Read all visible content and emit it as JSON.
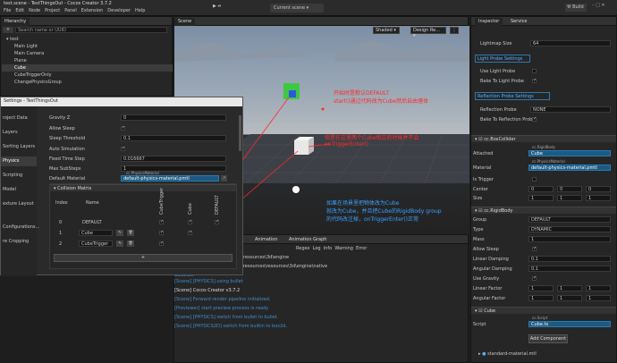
{
  "window": {
    "title": "test.scene - TestThingsOut - Cocos Creator 3.7.2"
  },
  "menu": [
    "File",
    "Edit",
    "Node",
    "Project",
    "Panel",
    "Extension",
    "Developer",
    "Help"
  ],
  "toolbar": {
    "scene_select": "Current scene",
    "build": "Build"
  },
  "hierarchy": {
    "title": "Hierarchy",
    "search_placeholder": "Search name or UUID",
    "nodes": [
      "test",
      "Main Light",
      "Main Camera",
      "Plane",
      "Cube",
      "CubeTriggerOnly",
      "ChangePhysicsGroup"
    ]
  },
  "scene": {
    "tab": "Scene",
    "shading": "Shaded",
    "design": "Design Re...",
    "annotations": [
      "开始时是默认DEFAULT",
      "start()通过代码改为Cube然后自由落体",
      "但是在这里两个Cube相交的时候并不会",
      "onTriggerEnter()",
      "如果在场景里把物体改为Cube",
      "就改为Cube，并且把Cube的RigidBody group",
      "的代码改注掉，onTriggerEnter()正常"
    ]
  },
  "bottom": {
    "tabs": [
      "Animation",
      "Animation Graph"
    ],
    "console_filters": [
      "Regex",
      "Log",
      "Info",
      "Warning",
      "Error"
    ],
    "paths": [
      "editor\\Creator\\3.7.2\\resources\\resources\\3d\\engine",
      "ata\\cocos\\editor\\Creator\\3.7.2\\resources\\resources\\3d\\engine\\native",
      "build.dts"
    ],
    "logs": [
      "[Scene] [PHYSICS] using bullet",
      "[Scene] Cocos Creator v3.7.2",
      "[Scene] Forward render pipeline initialized.",
      "[Previewer] start preview process is ready",
      "[Scene] [PHYSICS] switch from bullet to bullet.",
      "[Scene] [PHYSICS2D] switch from builtin to box2d."
    ]
  },
  "settings": {
    "title": "Settings - TestThingsOut",
    "side": [
      "roject Data",
      "Layers",
      "Sorting Layers",
      "Physics",
      "Scripting",
      "Model",
      "exture Layout",
      "Configurations...",
      "re Cropping"
    ],
    "fields": [
      {
        "label": "Gravity Z",
        "value": "0"
      },
      {
        "label": "Allow Sleep",
        "value": ""
      },
      {
        "label": "Sleep Threshold",
        "value": "0.1"
      },
      {
        "label": "Auto Simulation",
        "value": ""
      },
      {
        "label": "Fixed Time Step",
        "value": "0.016667"
      },
      {
        "label": "Max SubSteps",
        "value": "1"
      },
      {
        "label": "Default Material",
        "value": "default-physics-material.pmtl",
        "tag": "cc.PhysicsMaterial"
      }
    ],
    "matrix": {
      "title": "Collision Matrix",
      "col_index": "Index",
      "col_name": "Name",
      "col_headers": [
        "CubeTrigger",
        "Cube",
        "DEFAULT"
      ],
      "rows": [
        {
          "index": "0",
          "name": "DEFAULT"
        },
        {
          "index": "1",
          "name": "Cube"
        },
        {
          "index": "2",
          "name": "CubeTrigger"
        }
      ],
      "add": "+"
    }
  },
  "inspector": {
    "tabs": [
      "Inspector",
      "Service"
    ],
    "lightmap": {
      "label": "Lightmap Size",
      "value": "64"
    },
    "light_probe": {
      "title": "Light Probe Settings",
      "use": "Use Light Probe",
      "bake": "Bake To Light Probe"
    },
    "reflection": {
      "title": "Reflection Probe Settings",
      "probe_label": "Reflection Probe",
      "probe_value": "NONE",
      "bake": "Bake To Reflection Probe"
    },
    "box": {
      "title": "cc.BoxCollider",
      "attached_label": "Attached",
      "attached_tag": "cc.RigidBody",
      "attached_value": "Cube",
      "material_label": "Material",
      "material_tag": "cc.PhysicsMaterial",
      "material_value": "default-physics-material.pmtl",
      "trigger": "Is Trigger",
      "center": "Center",
      "size": "Size",
      "center_vals": [
        "0",
        "0",
        "0"
      ],
      "size_vals": [
        "1",
        "1",
        "1"
      ]
    },
    "rigid": {
      "title": "cc.RigidBody",
      "rows": [
        {
          "label": "Group",
          "value": "DEFAULT"
        },
        {
          "label": "Type",
          "value": "DYNAMIC"
        },
        {
          "label": "Mass",
          "value": "1"
        },
        {
          "label": "Allow Sleep",
          "value": ""
        },
        {
          "label": "Linear Damping",
          "value": "0.1"
        },
        {
          "label": "Angular Damping",
          "value": "0.1"
        },
        {
          "label": "Use Gravity",
          "value": ""
        },
        {
          "label": "Linear Factor",
          "value": ""
        },
        {
          "label": "Angular Factor",
          "value": ""
        }
      ],
      "factor_vals": [
        "1",
        "1",
        "1"
      ]
    },
    "cube": {
      "title": "Cube",
      "script_label": "Script",
      "script_tag": "cc.Script",
      "script_value": "Cube.ts"
    },
    "add_component": "Add Component",
    "footer": "standard-material.mtl"
  },
  "colors": {
    "accent": "#1c5a82",
    "annotation_red": "#ff2a2a",
    "annotation_blue": "#3aa0ff"
  }
}
